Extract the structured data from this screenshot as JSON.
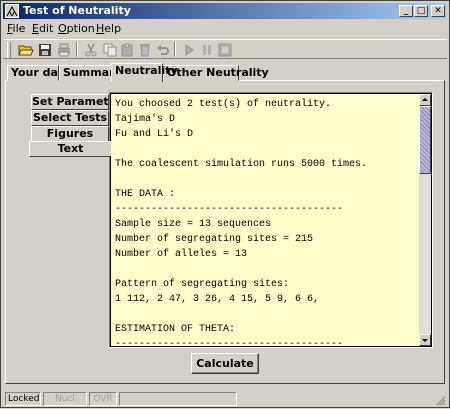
{
  "window": {
    "title": "Test of Neutrality",
    "icon": "phylogeny-tree-icon",
    "controls": [
      "minimize-icon",
      "maximize-icon",
      "close-icon"
    ]
  },
  "menu": {
    "items": [
      {
        "label": "File"
      },
      {
        "label": "Edit"
      },
      {
        "label": "Option"
      },
      {
        "label": "Help"
      }
    ]
  },
  "toolbar": {
    "buttons": [
      {
        "icon": "open-folder-icon",
        "enabled": true
      },
      {
        "icon": "save-disk-icon",
        "enabled": true
      },
      {
        "icon": "print-icon",
        "enabled": false
      },
      {
        "icon": "cut-icon",
        "enabled": false
      },
      {
        "icon": "copy-icon",
        "enabled": false
      },
      {
        "icon": "paste-icon",
        "enabled": false
      },
      {
        "icon": "delete-icon",
        "enabled": false
      },
      {
        "icon": "undo-icon",
        "enabled": false
      },
      {
        "icon": "play-icon",
        "enabled": false
      },
      {
        "icon": "pause-icon",
        "enabled": false
      },
      {
        "icon": "stop-icon",
        "enabled": false
      }
    ]
  },
  "tabs": {
    "items": [
      {
        "label": "Your data"
      },
      {
        "label": "Summary"
      },
      {
        "label": "Neutrality"
      },
      {
        "label": "Other Neutrality"
      }
    ],
    "active": "Neutrality"
  },
  "side_tabs": {
    "items": [
      {
        "label": "Set Parameters"
      },
      {
        "label": "Select Tests"
      },
      {
        "label": "Figures"
      },
      {
        "label": "Text"
      }
    ],
    "active": "Text"
  },
  "output": {
    "lines": [
      "You choosed 2 test(s) of neutrality.",
      "Tajima's D",
      "Fu and Li's D",
      "",
      "The coalescent simulation runs 5000 times.",
      "",
      "THE DATA :",
      "--------------------------------------",
      "Sample size = 13 sequences",
      "Number of segregating sites = 215",
      "Number of alleles = 13",
      "",
      "Pattern of segregating sites:",
      "1 112, 2 47, 3 26, 4 15, 5 9, 6 6,",
      "",
      "ESTIMATION OF THETA:",
      "--------------------------------------"
    ],
    "background": "#ffffcc"
  },
  "actions": {
    "calculate_label": "Calculate"
  },
  "status": {
    "locked": "Locked",
    "nucl": "Nucl",
    "ovr": "OVR",
    "message": ""
  }
}
